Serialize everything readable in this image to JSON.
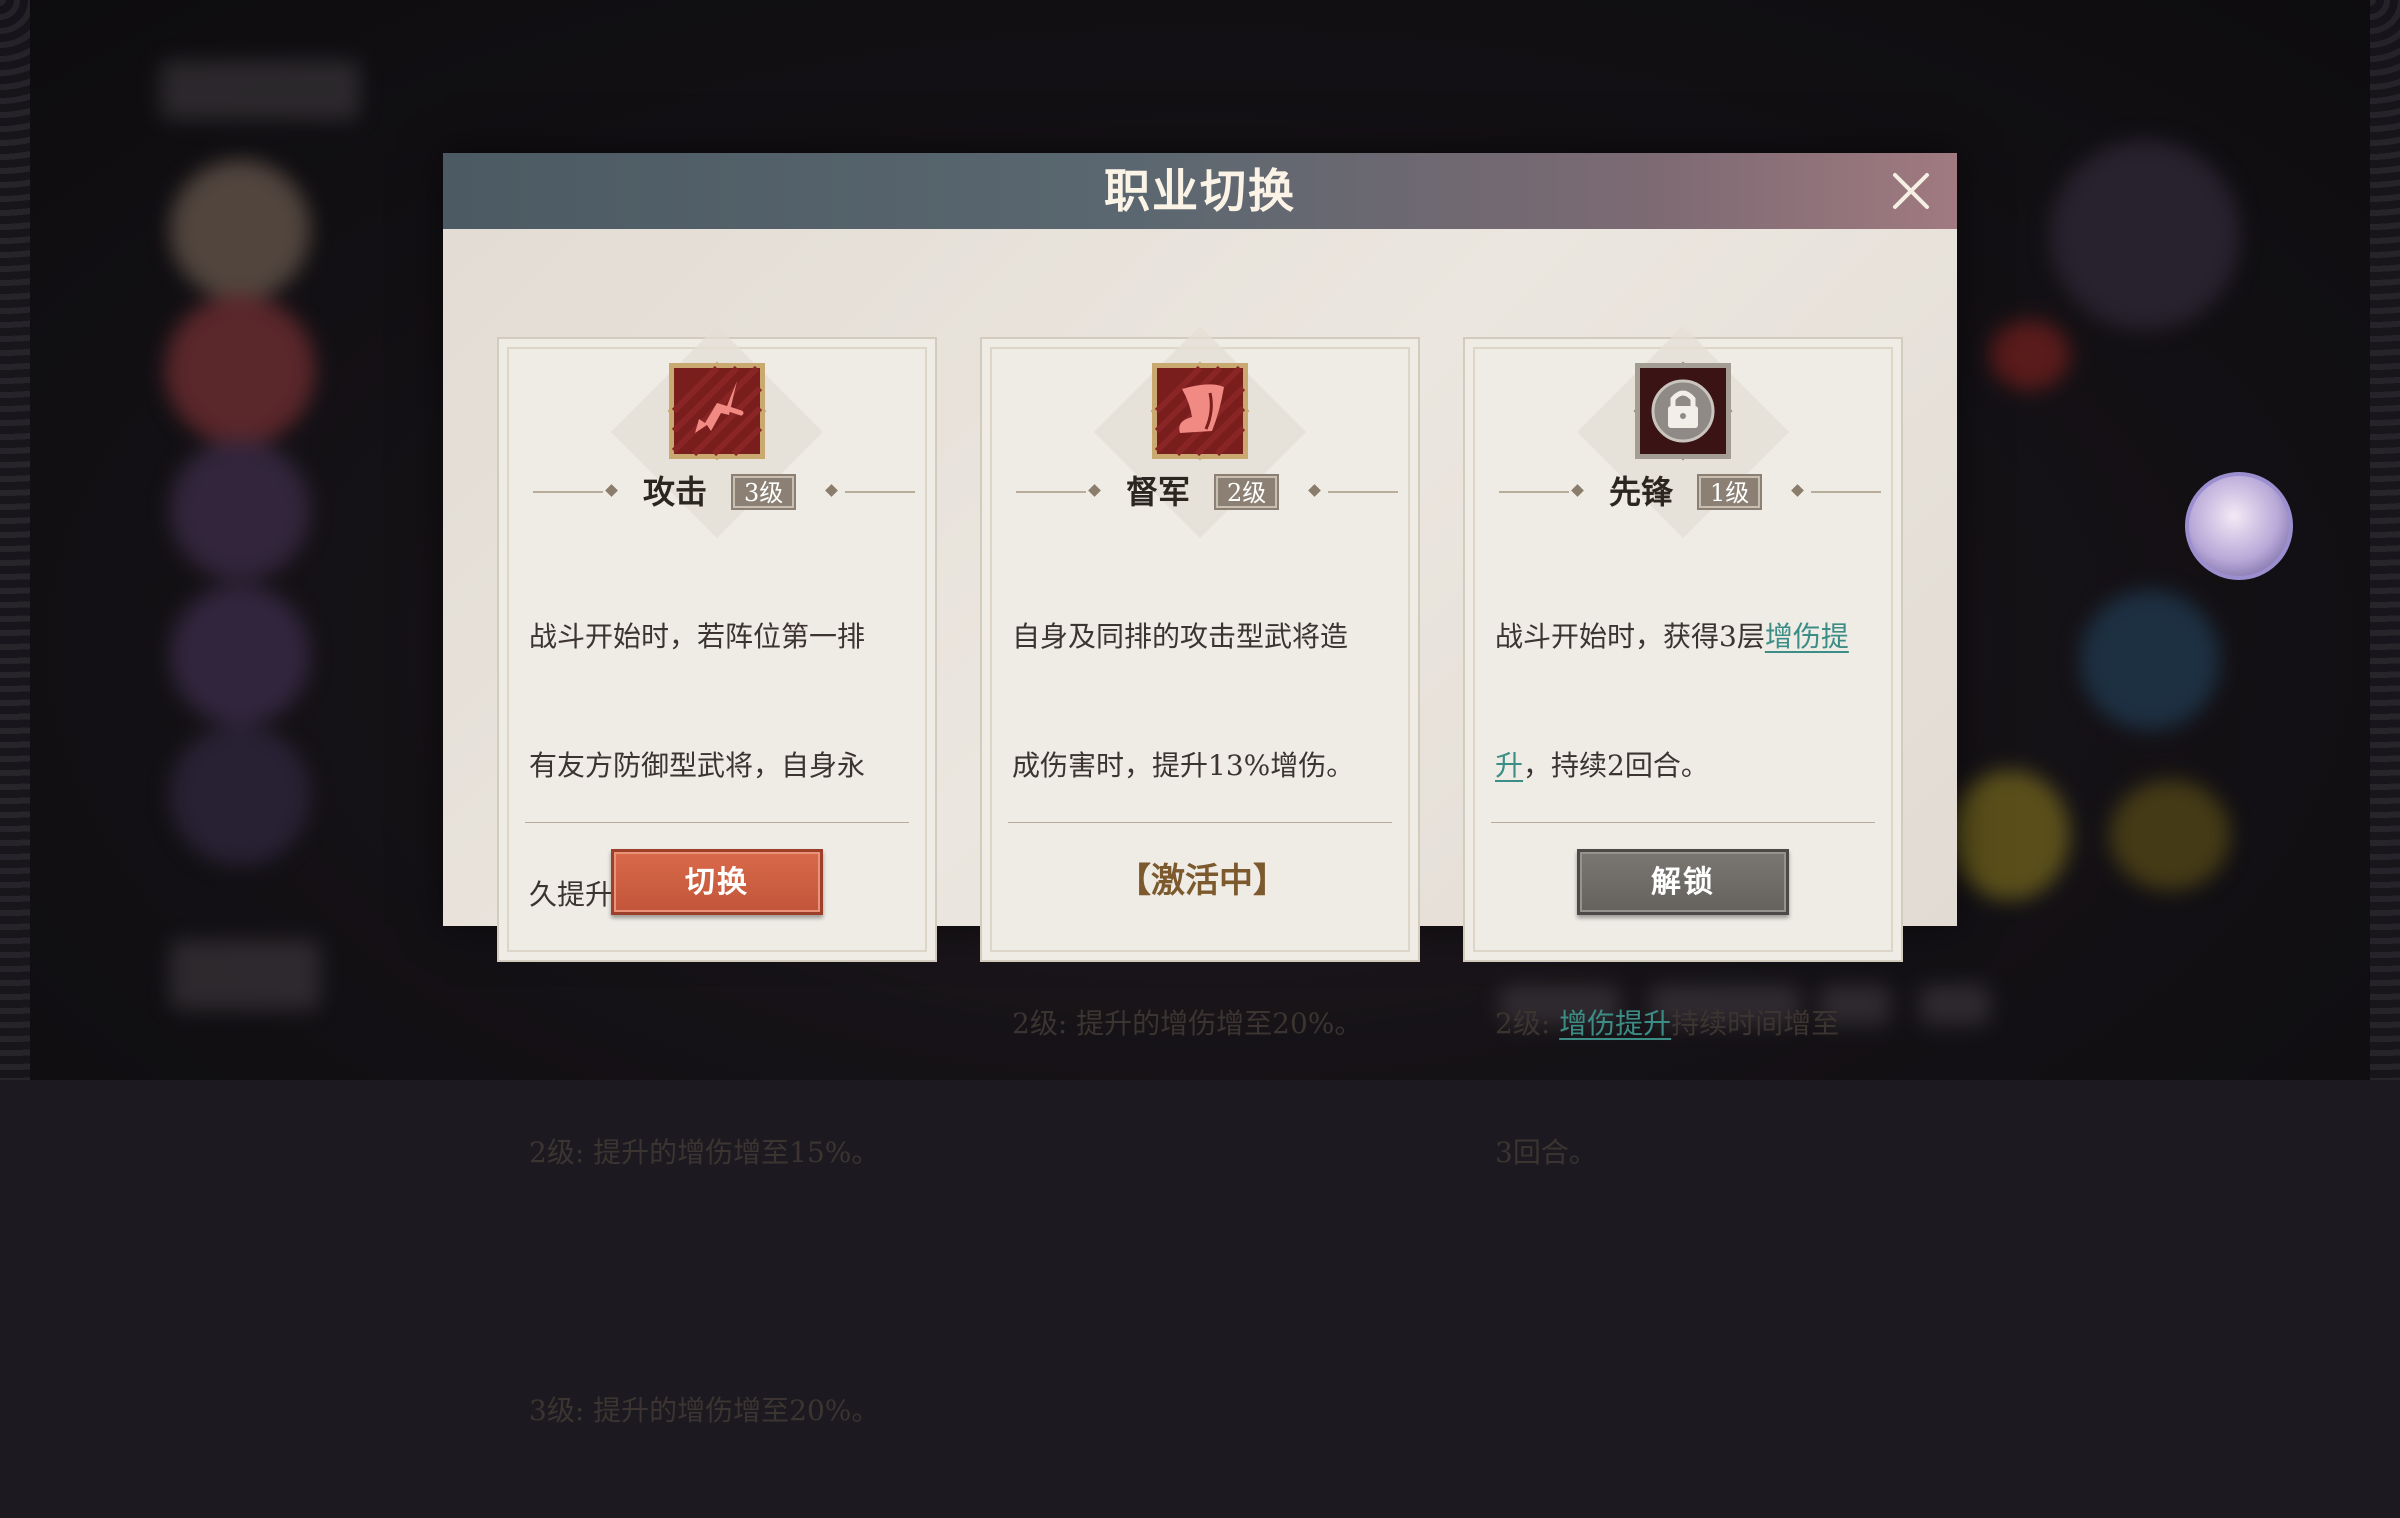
{
  "modal": {
    "title": "职业切换",
    "close_icon": "close-icon"
  },
  "cards": [
    {
      "icon": "sword-icon",
      "name": "攻击",
      "level": "3级",
      "description_lines": [
        "战斗开始时，若阵位第一排",
        "有友方防御型武将，自身永",
        "久提升10%增伤。",
        "",
        "2级: 提升的增伤增至15%。",
        "",
        "3级: 提升的增伤增至20%。"
      ],
      "action_label": "切换",
      "action_type": "button"
    },
    {
      "icon": "horn-icon",
      "name": "督军",
      "level": "2级",
      "description_lines": [
        "自身及同排的攻击型武将造",
        "成伤害时，提升13%增伤。",
        "",
        "2级: 提升的增伤增至20%。"
      ],
      "action_label": "激活中",
      "action_type": "status"
    },
    {
      "icon": "lock-icon",
      "name": "先锋",
      "level": "1级",
      "desc_line1_pre": "战斗开始时，获得3层",
      "desc_link": "增伤提升",
      "desc_line2_post": "，持续2回合。",
      "desc_level2_pre": "2级: ",
      "desc_level2_post": "持续时间增至",
      "desc_level2_last": "3回合。",
      "action_label": "解锁",
      "action_type": "button"
    }
  ],
  "colors": {
    "header_start": "#4c5a63",
    "header_end": "#a07a80",
    "switch_button": "#c9593d",
    "unlock_button": "#6e6a66",
    "link": "#3b8d86",
    "icon_red": "#7a1d1d",
    "icon_dark": "#3a1414"
  }
}
